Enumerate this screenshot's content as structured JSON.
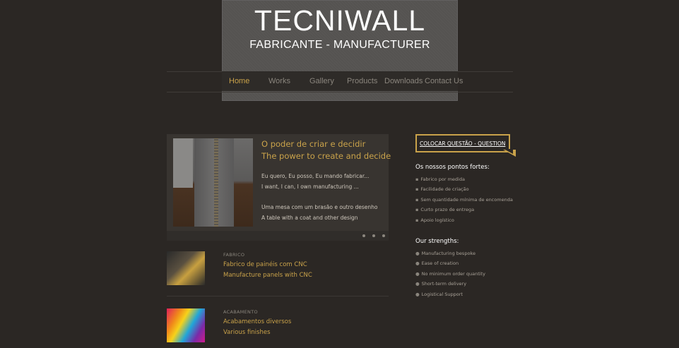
{
  "header": {
    "title": "TECNIWALL",
    "subtitle": "FABRICANTE - MANUFACTURER"
  },
  "nav": {
    "items": [
      "Home",
      "Works",
      "Gallery",
      "Products",
      "Downloads",
      "Contact Us"
    ],
    "active": "Home"
  },
  "slider": {
    "title_pt": "O poder de criar e decidir",
    "title_en": "The power to create and decide",
    "line1": "Eu quero, Eu posso, Eu mando fabricar...",
    "line2": "I want, I can, I own manufacturing ...",
    "line3": "Uma mesa com um brasão e outro desenho",
    "line4": "A table with a coat and other design"
  },
  "features": [
    {
      "label": "FABRICO",
      "line1": "Fabrico de painéis com CNC",
      "line2": "Manufacture panels with CNC"
    },
    {
      "label": "ACABAMENTO",
      "line1": "Acabamentos diversos",
      "line2": "Various finishes"
    }
  ],
  "sidebar": {
    "question_button": "COLOCAR QUESTÃO - QUESTION",
    "heading_pt": "Os nossos pontos fortes:",
    "items_pt": [
      "Fabrico por medida",
      "Facilidade de criação",
      "Sem quantidade mínima de encomenda",
      "Curto prazo de entrega",
      "Apoio logístico"
    ],
    "heading_en": "Our strengths:",
    "items_en": [
      "Manufacturing bespoke",
      "Ease of creation",
      "No minimum order quantity",
      "Short-term delivery",
      "Logistical Support"
    ]
  },
  "colors": {
    "background": "#2b2724",
    "accent": "#c9a24a",
    "header_panel": "#555351"
  }
}
